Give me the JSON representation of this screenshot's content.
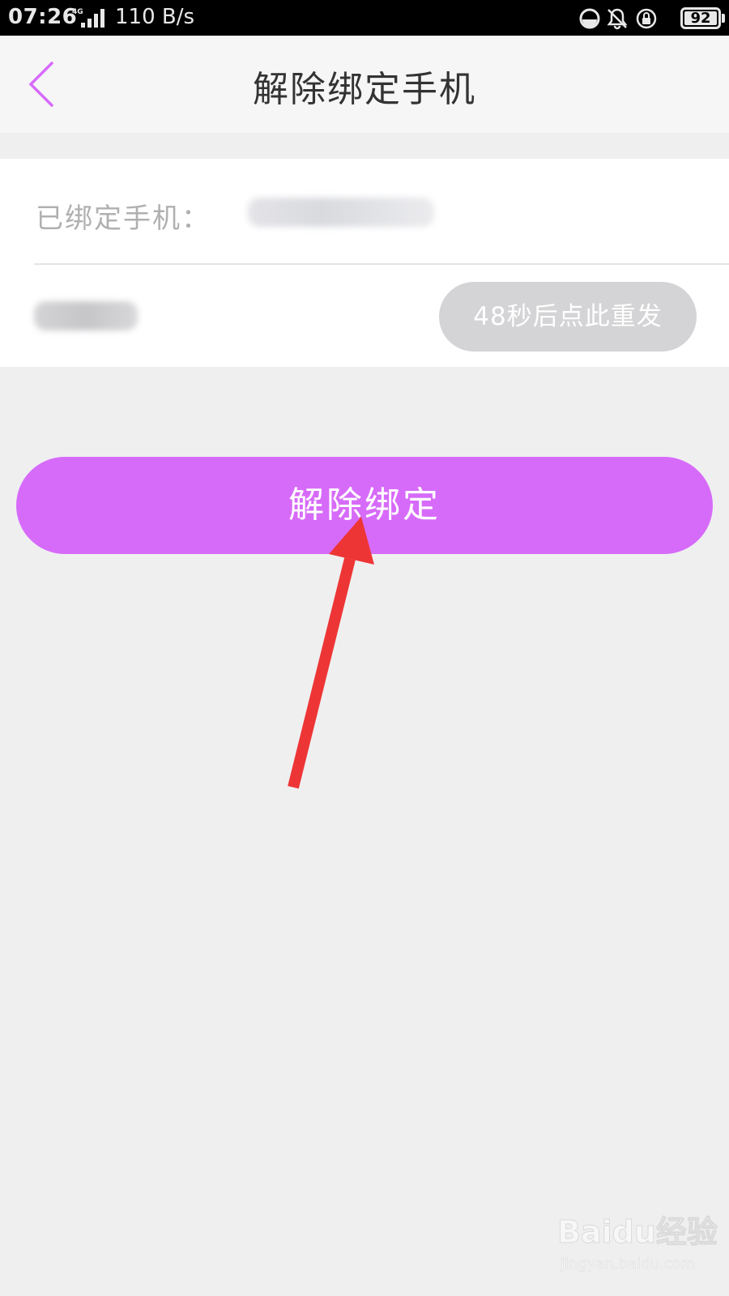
{
  "status_bar": {
    "time": "07:26",
    "network_type": "4G",
    "net_speed": "110 B/s",
    "battery": "92",
    "icons": [
      "data-saver-icon",
      "bell-muted-icon",
      "rotation-lock-icon",
      "battery-icon"
    ]
  },
  "nav": {
    "back_icon": "chevron-left-icon",
    "title": "解除绑定手机",
    "accent_color": "#d76bf9"
  },
  "form": {
    "bound_label": "已绑定手机：",
    "resend_label": "48秒后点此重发"
  },
  "actions": {
    "unbind_label": "解除绑定",
    "unbind_color": "#d76bf9"
  },
  "annotation": {
    "arrow_color": "#ee3535"
  },
  "watermark": {
    "logo": "Baidu经验",
    "url": "jingyan.baidu.com"
  }
}
